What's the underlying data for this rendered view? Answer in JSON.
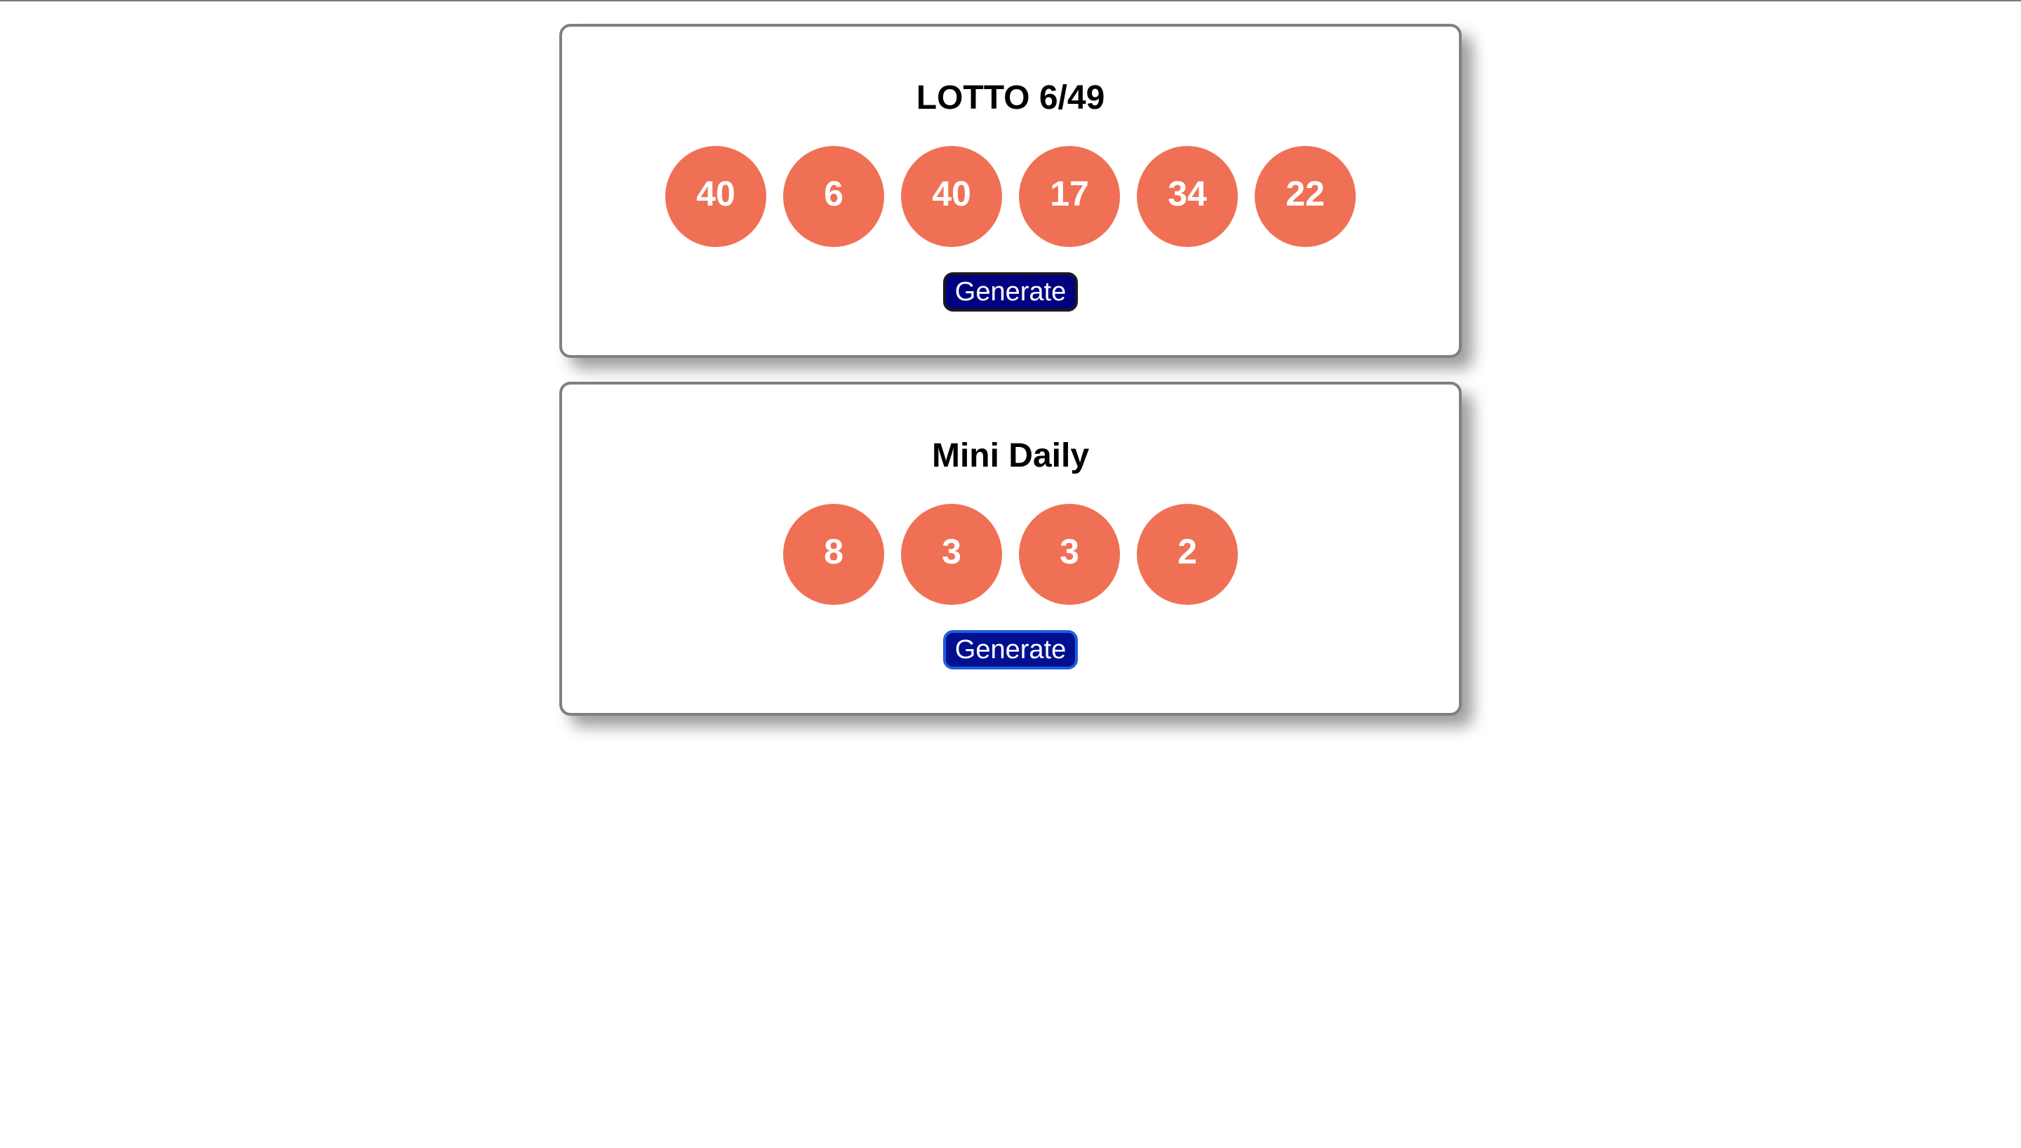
{
  "colors": {
    "ball": "#f07055",
    "button": "#000080",
    "card_border": "#808080"
  },
  "cards": [
    {
      "title": "LOTTO 6/49",
      "numbers": [
        "40",
        "6",
        "40",
        "17",
        "34",
        "22"
      ],
      "button_label": "Generate"
    },
    {
      "title": "Mini Daily",
      "numbers": [
        "8",
        "3",
        "3",
        "2"
      ],
      "button_label": "Generate"
    }
  ]
}
